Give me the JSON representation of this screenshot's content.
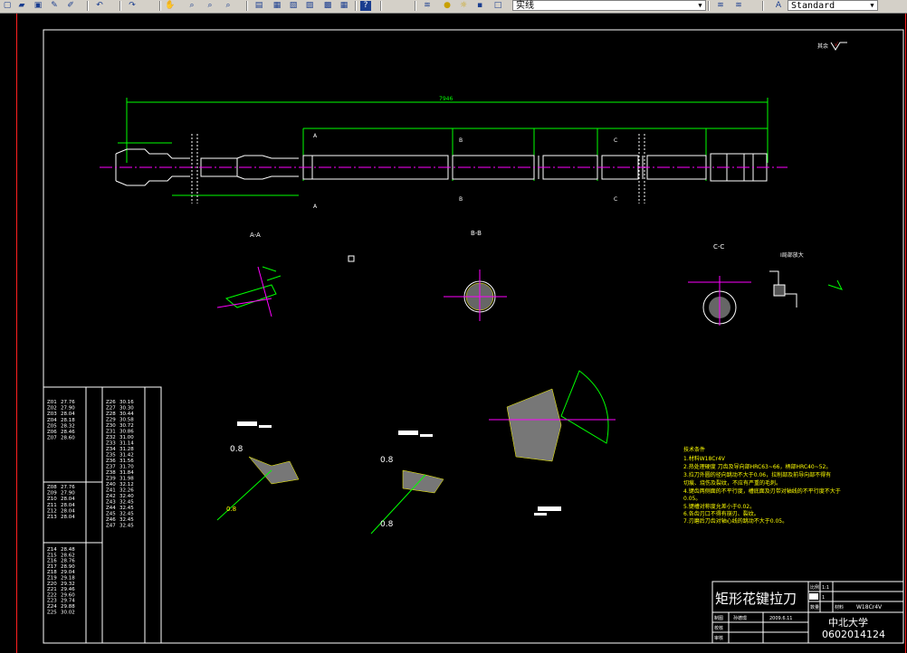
{
  "toolbar": {
    "icons": [
      "new-file-icon",
      "open-folder-icon",
      "save-icon",
      "pen-icon",
      "brush-icon",
      "undo-icon",
      "redo-icon",
      "pan-hand-icon",
      "zoom-realtime-icon",
      "zoom-window-icon",
      "zoom-previous-icon",
      "properties-icon",
      "design-center-icon",
      "tool-palette-icon",
      "sheet-set-icon",
      "markup-icon",
      "calculator-icon",
      "help-icon",
      "layers-icon",
      "light-bulb-icon",
      "sun-icon",
      "lock-icon",
      "color-square-icon"
    ],
    "layer_value": "实线",
    "text_style_value": "Standard"
  },
  "drawing": {
    "overall_dim": "7946",
    "section_labels": [
      "A-A",
      "B-B",
      "C-C"
    ],
    "cut_labels": [
      "A",
      "A",
      "B",
      "B",
      "C",
      "C"
    ],
    "detail_label": "I局部放大",
    "corner_note": "其余",
    "dims": [
      "0.8",
      "0.8",
      "0.8",
      "0.8",
      "8",
      "2.5",
      "5"
    ],
    "tech_requirements": [
      "技术条件",
      "1.材料W18Cr4V",
      "2.热处理硬度  刀齿及导向部HRC63~66，柄部HRC40~52。",
      "3.拉刀外圆的径向跳动不大于0.06，拉削部及前导向部不得有",
      "   切痕、烧伤及裂纹，不应有严重的毛刺。",
      "4.键齿两侧面的不平行度，槽底面及刃带对轴线的不平行度不大于",
      "0.05。",
      "5.键槽对称度允差小于0.02。",
      "6.各齿刃口不得有崩刃、裂纹。",
      "7.刃磨后刀齿对轴心线的跳动不大于0.05。"
    ]
  },
  "tooth_table": {
    "col1_block1": [
      [
        "Z01",
        "27.76"
      ],
      [
        "Z02",
        "27.90"
      ],
      [
        "Z03",
        "28.04"
      ],
      [
        "Z04",
        "28.18"
      ],
      [
        "Z05",
        "28.32"
      ],
      [
        "Z06",
        "28.46"
      ],
      [
        "Z07",
        "28.60"
      ]
    ],
    "col1_block2": [
      [
        "Z08",
        "27.76"
      ],
      [
        "Z09",
        "27.90"
      ],
      [
        "Z10",
        "28.04"
      ],
      [
        "Z11",
        "28.04"
      ],
      [
        "Z12",
        "28.04"
      ],
      [
        "Z13",
        "28.04"
      ]
    ],
    "col1_block3": [
      [
        "Z14",
        "28.48"
      ],
      [
        "Z15",
        "28.62"
      ],
      [
        "Z16",
        "28.76"
      ],
      [
        "Z17",
        "28.90"
      ],
      [
        "Z18",
        "29.04"
      ],
      [
        "Z19",
        "29.18"
      ],
      [
        "Z20",
        "29.32"
      ],
      [
        "Z21",
        "29.46"
      ],
      [
        "Z22",
        "29.60"
      ],
      [
        "Z23",
        "29.74"
      ],
      [
        "Z24",
        "29.88"
      ],
      [
        "Z25",
        "30.02"
      ]
    ],
    "col2": [
      [
        "Z26",
        "30.16"
      ],
      [
        "Z27",
        "30.30"
      ],
      [
        "Z28",
        "30.44"
      ],
      [
        "Z29",
        "30.58"
      ],
      [
        "Z30",
        "30.72"
      ],
      [
        "Z31",
        "30.86"
      ],
      [
        "Z32",
        "31.00"
      ],
      [
        "Z33",
        "31.14"
      ],
      [
        "Z34",
        "31.28"
      ],
      [
        "Z35",
        "31.42"
      ],
      [
        "Z36",
        "31.56"
      ],
      [
        "Z37",
        "31.70"
      ],
      [
        "Z38",
        "31.84"
      ],
      [
        "Z39",
        "31.98"
      ],
      [
        "Z40",
        "32.12"
      ],
      [
        "Z41",
        "32.26"
      ],
      [
        "Z42",
        "32.40"
      ],
      [
        "Z43",
        "32.45"
      ],
      [
        "Z44",
        "32.45"
      ],
      [
        "Z45",
        "32.45"
      ],
      [
        "Z46",
        "32.45"
      ],
      [
        "Z47",
        "32.45"
      ]
    ]
  },
  "title_block": {
    "title": "矩形花键拉刀",
    "scale_label": "比例",
    "scale_value": "1:1",
    "qty_label": "数量",
    "qty_value": "1",
    "material_label": "材料",
    "material_value": "W18Cr4V",
    "drawn_label": "制图",
    "drawn_name": "孙德璟",
    "date": "2009.6.11",
    "check_label": "校核",
    "review_label": "审核",
    "school": "中北大学",
    "student_no": "0602014124"
  }
}
